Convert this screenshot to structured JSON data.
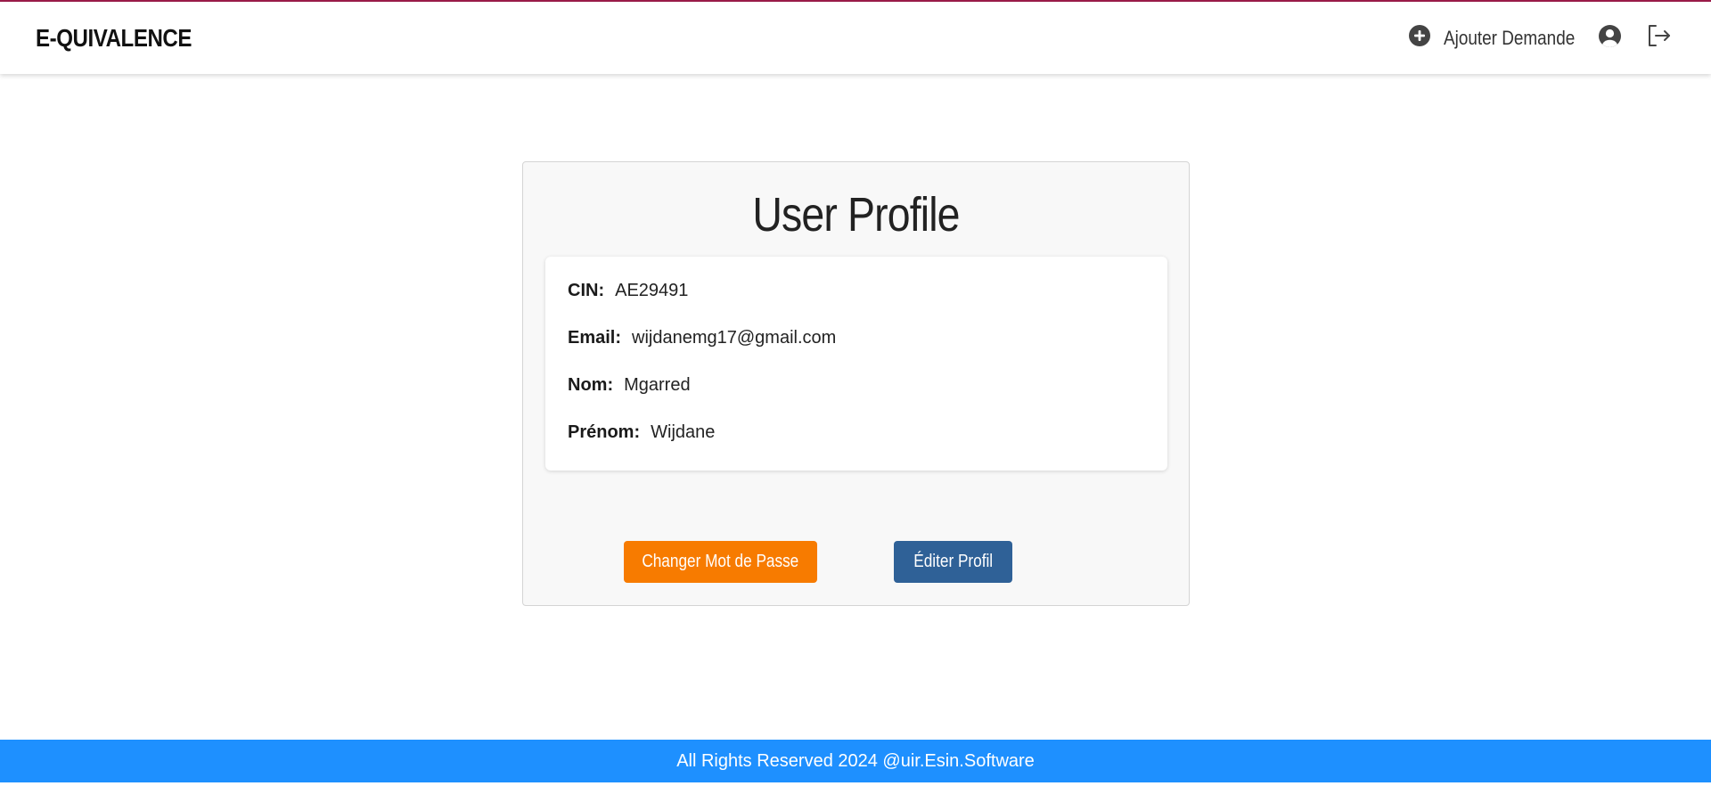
{
  "header": {
    "brand": "E-QUIVALENCE",
    "add_request_label": "Ajouter Demande",
    "accent_color": "#9c1c4a"
  },
  "profile": {
    "title": "User Profile",
    "fields": [
      {
        "label": "CIN:",
        "value": "AE29491"
      },
      {
        "label": "Email:",
        "value": "wijdanemg17@gmail.com"
      },
      {
        "label": "Nom:",
        "value": "Mgarred"
      },
      {
        "label": "Prénom:",
        "value": "Wijdane"
      }
    ],
    "change_password_label": "Changer Mot de Passe",
    "edit_profile_label": "Éditer Profil",
    "change_password_color": "#f77b00",
    "edit_profile_color": "#2f6197"
  },
  "footer": {
    "text": "All Rights Reserved 2024 @uir.Esin.Software",
    "color": "#1e90ff"
  },
  "icons": {
    "add": "plus-circle-icon",
    "user": "user-circle-icon",
    "logout": "logout-icon"
  }
}
